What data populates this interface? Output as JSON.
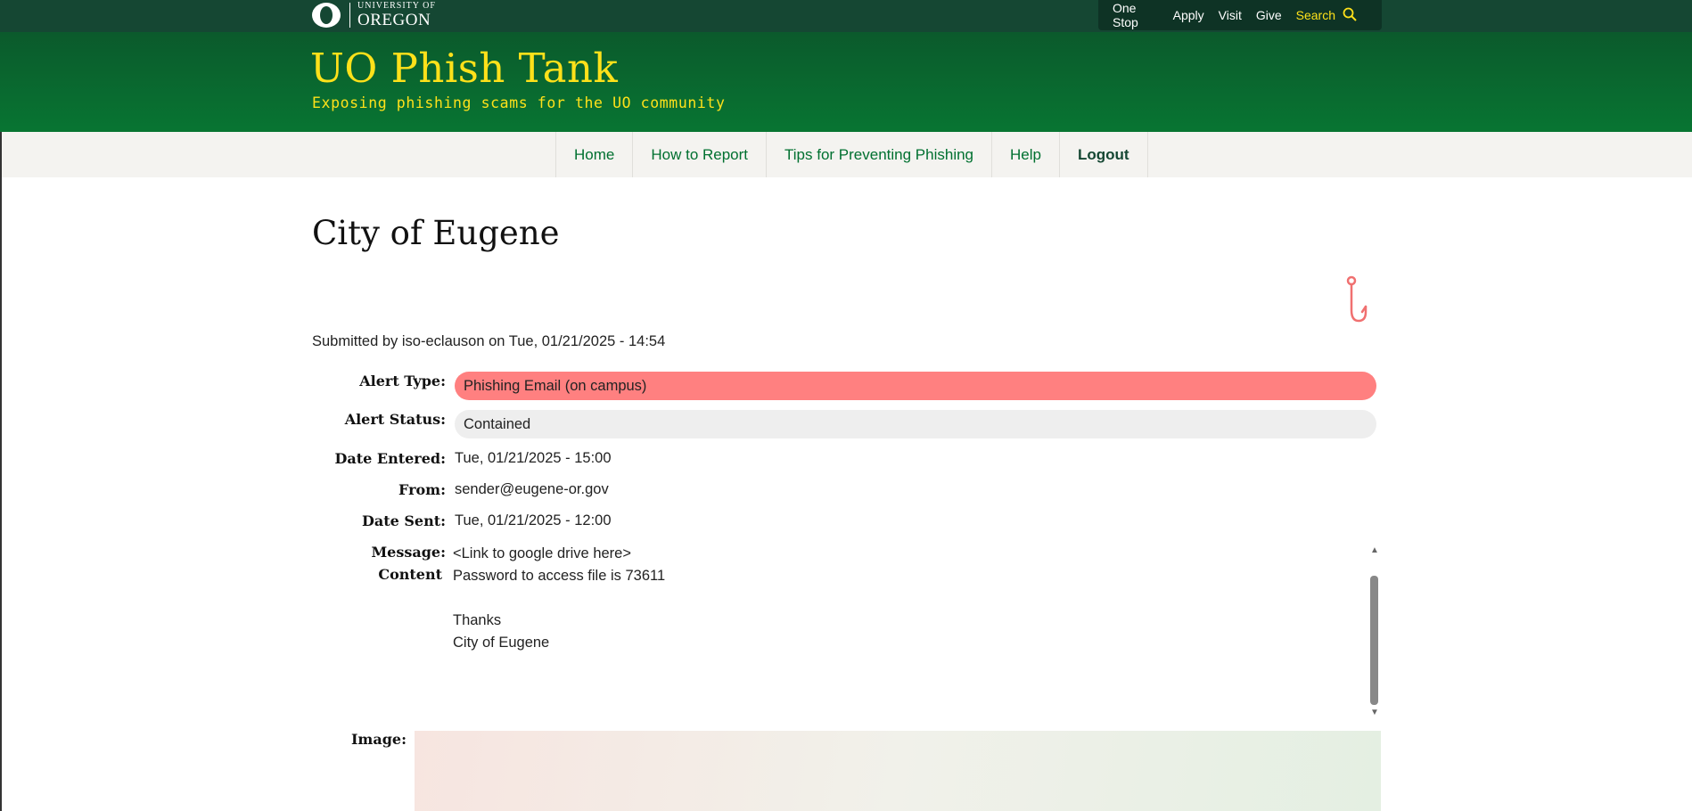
{
  "top_bar": {
    "logo_small": "UNIVERSITY OF",
    "logo_big": "OREGON",
    "links": [
      "One Stop",
      "Apply",
      "Visit",
      "Give"
    ],
    "search_label": "Search",
    "accent_color": "#fee11a",
    "background_color": "#154733"
  },
  "header": {
    "site_title": "UO Phish Tank",
    "slogan": "Exposing phishing scams for the UO community"
  },
  "nav": {
    "items": [
      "Home",
      "How to Report",
      "Tips for Preventing Phishing",
      "Help",
      "Logout"
    ]
  },
  "page": {
    "title": "City of Eugene",
    "submitted": "Submitted by iso-eclauson  on Tue, 01/21/2025 - 14:54",
    "fields": {
      "alert_type_label": "Alert Type:",
      "alert_type_value": "Phishing Email (on campus)",
      "alert_status_label": "Alert Status:",
      "alert_status_value": "Contained",
      "date_entered_label": "Date Entered:",
      "date_entered_value": "Tue, 01/21/2025 - 15:00",
      "from_label": "From:",
      "from_value": "sender@eugene-or.gov",
      "date_sent_label": "Date Sent:",
      "date_sent_value": "Tue, 01/21/2025 - 12:00",
      "message_label": "Message:",
      "content_label": "Content",
      "image_label": "Image:"
    },
    "message_lines": [
      "<Link to google drive here>",
      "Password to access file is 73611",
      "",
      "Thanks",
      "City of Eugene"
    ],
    "alert_type_color": "#ff8080",
    "alert_status_color": "#eeeeee"
  },
  "icons": [
    "uo-o-logo-icon",
    "search-icon",
    "fishhook-icon",
    "scroll-up-icon",
    "scroll-down-icon"
  ]
}
